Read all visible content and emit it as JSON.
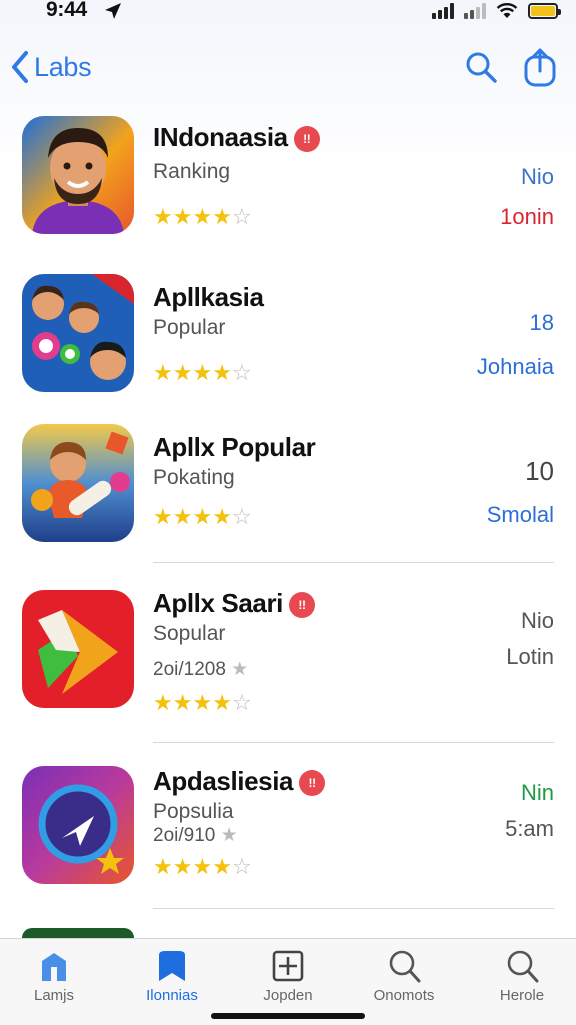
{
  "status_bar": {
    "time": "9:44"
  },
  "nav": {
    "back_label": "Labs",
    "icons": [
      "search-icon",
      "share-icon"
    ]
  },
  "apps": [
    {
      "name": "INdonaasia",
      "badge": "!!",
      "subtitle": "Ranking",
      "extra": "",
      "rating": 4,
      "right_top": "Nio",
      "right_bottom": "1onin",
      "right_top_color": "#3b73c9",
      "right_bottom_color": "#d9252e"
    },
    {
      "name": "Apllkasia",
      "badge": "",
      "subtitle": "Popular",
      "extra": "",
      "rating": 4,
      "right_top": "18",
      "right_bottom": "Johnaia",
      "right_top_color": "#2b6fd6",
      "right_bottom_color": "#2b6fd6"
    },
    {
      "name": "Apllx Popular",
      "badge": "",
      "subtitle": "Pokating",
      "extra": "",
      "rating": 4,
      "right_top": "10",
      "right_bottom": "Smolal",
      "right_top_color": "#444444",
      "right_bottom_color": "#2b6fd6"
    },
    {
      "name": "Apllx Saari",
      "badge": "!!",
      "subtitle": "Sopular",
      "extra": "2oi/1208",
      "rating": 4,
      "right_top": "Nio",
      "right_bottom": "Lotin",
      "right_top_color": "#555555",
      "right_bottom_color": "#555555"
    },
    {
      "name": "Apdasliesia",
      "badge": "!!",
      "subtitle": "Popsulia",
      "extra": "2oi/910",
      "rating": 4,
      "right_top": "Nin",
      "right_bottom": "5:am",
      "right_top_color": "#1f9a45",
      "right_bottom_color": "#555555"
    }
  ],
  "tabs": [
    {
      "label": "Lamjs",
      "icon": "map-pin-icon",
      "active": false
    },
    {
      "label": "Ilonnias",
      "icon": "bookmark-icon",
      "active": true
    },
    {
      "label": "Jopden",
      "icon": "plus-square-icon",
      "active": false
    },
    {
      "label": "Onomots",
      "icon": "search-icon",
      "active": false
    },
    {
      "label": "Herole",
      "icon": "search-icon",
      "active": false
    }
  ]
}
